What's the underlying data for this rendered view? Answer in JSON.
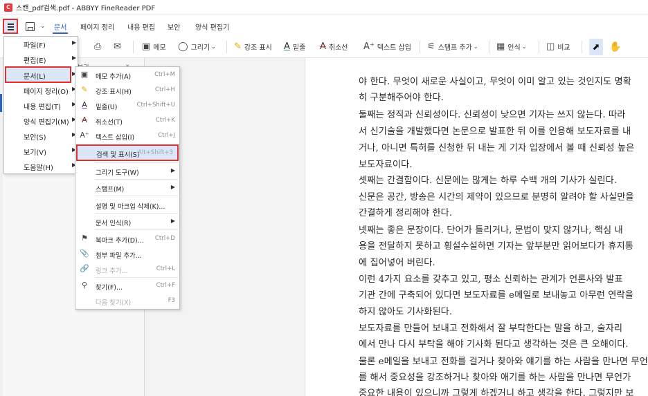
{
  "window": {
    "title": "스캔_pdf검색.pdf - ABBYY FineReader PDF",
    "app_icon": "abbyy-app-icon"
  },
  "ribbon_tabs": [
    {
      "label": "문서",
      "active": true
    },
    {
      "label": "페이지 정리"
    },
    {
      "label": "내용 편집"
    },
    {
      "label": "보안"
    },
    {
      "label": "양식 편집기"
    }
  ],
  "toolbar": {
    "memo": "메모",
    "draw": "그리기",
    "highlight": "강조 표시",
    "underline": "밑줄",
    "strikeout": "취소선",
    "insert_text": "텍스트 삽입",
    "stamp_add": "스탬프 추가",
    "recognize": "인식",
    "compare": "비교"
  },
  "main_menu": {
    "items": [
      {
        "label": "파일(F)",
        "has_submenu": true
      },
      {
        "label": "편집(E)",
        "has_submenu": true
      },
      {
        "label": "문서(L)",
        "has_submenu": true,
        "selected": true
      },
      {
        "label": "페이지 정리(O)",
        "has_submenu": true
      },
      {
        "label": "내용 편집(T)",
        "has_submenu": true
      },
      {
        "label": "양식 편집기(M)",
        "has_submenu": true
      },
      {
        "label": "보안(S)",
        "has_submenu": true
      },
      {
        "label": "보기(V)",
        "has_submenu": true
      },
      {
        "label": "도움말(H)",
        "has_submenu": true
      }
    ]
  },
  "document_submenu": {
    "items": [
      {
        "label": "메모 추가(A)",
        "shortcut": "Ctrl+M",
        "icon": "memo-icon"
      },
      {
        "label": "강조 표시(H)",
        "shortcut": "Ctrl+H",
        "icon": "highlighter-icon"
      },
      {
        "label": "밑줄(U)",
        "shortcut": "Ctrl+Shift+U",
        "icon": "underline-icon"
      },
      {
        "label": "취소선(T)",
        "shortcut": "Ctrl+K",
        "icon": "strikeout-icon"
      },
      {
        "label": "텍스트 삽입(I)",
        "shortcut": "Ctrl+J",
        "icon": "insert-text-icon"
      },
      {
        "label": "검색 및 표시(S)",
        "shortcut": "Alt+Shift+3",
        "icon": "",
        "selected": true
      },
      {
        "label": "그리기 도구(W)",
        "has_submenu": true
      },
      {
        "label": "스탬프(M)",
        "has_submenu": true
      },
      {
        "label": "설명 및 마크업 삭제(K)..."
      },
      {
        "label": "문서 인식(R)",
        "has_submenu": true
      },
      {
        "label": "북마크 추가(D)...",
        "shortcut": "Ctrl+D",
        "icon": "bookmark-icon"
      },
      {
        "label": "첨부 파일 추가...",
        "icon": "paperclip-icon"
      },
      {
        "label": "링크 추가...",
        "shortcut": "Ctrl+L",
        "icon": "link-icon",
        "disabled": true
      },
      {
        "label": "찾기(F)...",
        "shortcut": "Ctrl+F",
        "icon": "search-icon"
      },
      {
        "label": "다음 찾기(X)",
        "shortcut": "F3",
        "disabled": true
      }
    ]
  },
  "panel": {
    "header_fragment": "보기"
  },
  "document_text": [
    "야 한다. 무엇이 새로운 사실이고, 무엇이 이미 알고 있는 것인지도 명확",
    "히 구분해주어야 한다.",
    "  둘째는 정직과 신뢰성이다. 신뢰성이 낮으면 기자는 쓰지 않는다. 따라",
    "서 신기술을 개발했다면 논문으로 발표한 뒤 이를 인용해 보도자료를 내",
    "거나, 아니면 특허를 신청한 뒤 내는 게 기자 입장에서 볼 때 신뢰성 높은",
    "보도자료이다.",
    "  셋째는 간결함이다. 신문에는 많게는 하루 수백 개의 기사가 실린다.",
    "신문은 공간, 방송은 시간의 제약이 있으므로 분명히 알려야 할 사실만을",
    "간결하게 정리해야 한다.",
    "  넷째는 좋은 문장이다. 단어가 틀리거나, 문법이 맞지 않거나, 핵심 내",
    "용을 전달하지 못하고 횡설수설하면 기자는 앞부분만 읽어보다가 휴지통",
    "에 집어넣어 버린다.",
    "  이런 4가지 요소를 갖추고 있고, 평소 신뢰하는 관계가 언론사와 발표",
    "기관 간에 구축되어 있다면 보도자료를 e메일로 보내놓고 아무런 연락을",
    "하지 않아도 기사화된다.",
    "  보도자료를 만들어 보내고 전화해서 잘 부탁한다는 말을 하고, 술자리",
    "에서 만나 다시 부탁을 해야 기사화 된다고 생각하는 것은 큰 오해이다.",
    "  물론 e메일을 보내고 전화를 걸거나 찾아와 얘기를 하는 사람을 만나면 무언가",
    "를 해서 중요성을 강조하거나 찾아와 애기를 하는 사람을 만나면 무언가",
    "중요한 내용이 있으니까 그렇게 하겠거니 하고 생각을 한다. 그렇지만 보"
  ]
}
